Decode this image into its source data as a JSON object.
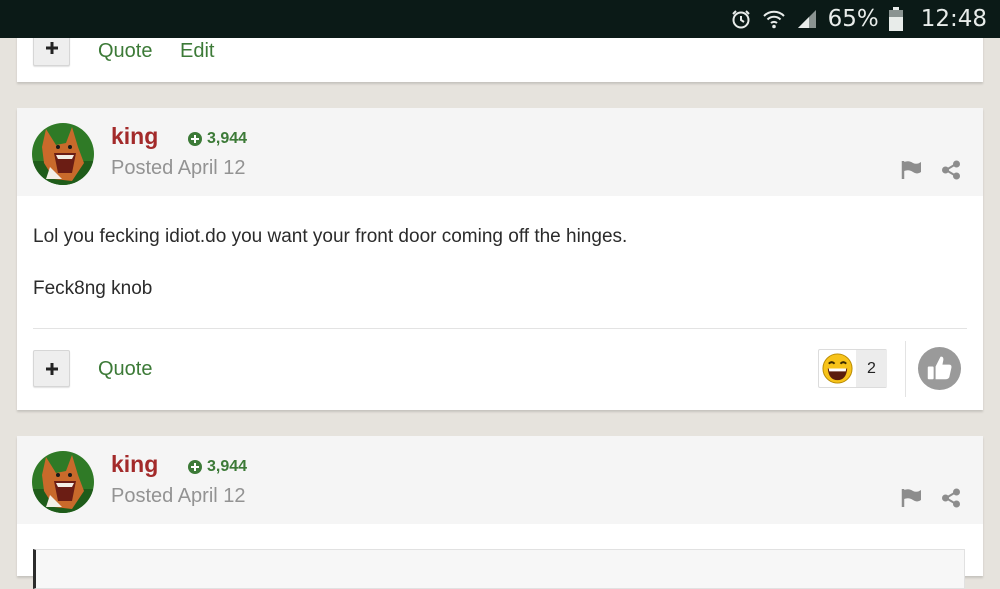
{
  "status_bar": {
    "icons": [
      "alarm-icon",
      "wifi-icon",
      "signal-icon",
      "battery-icon"
    ],
    "battery": "65%",
    "time": "12:48"
  },
  "colors": {
    "status_bar_bg": "#0b1a17",
    "page_bg": "#e6e3dd",
    "author": "#a32a2a",
    "accent_green": "#3c7a37",
    "meta_gray": "#939393"
  },
  "top_post": {
    "plus_icon": "plus-icon",
    "quote_label": "Quote",
    "edit_label": "Edit"
  },
  "post": {
    "author": "king",
    "reputation": "3,944",
    "posted": "Posted April 12",
    "paragraphs": [
      "Lol you fecking idiot.do you want your front door coming off the hinges.",
      "Feck8ng knob"
    ],
    "quote_label": "Quote",
    "reaction": {
      "icon": "laughing-emoji-icon",
      "count": "2"
    },
    "like_icon": "thumbs-up-icon",
    "header_icons": [
      "flag-icon",
      "share-icon"
    ]
  },
  "next_post": {
    "author": "king",
    "reputation": "3,944",
    "posted": "Posted April 12"
  }
}
